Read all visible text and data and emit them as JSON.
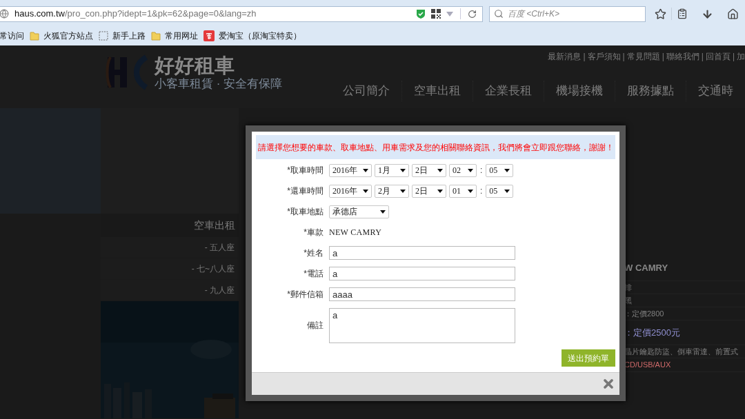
{
  "browser": {
    "url_host": "haus.com.tw",
    "url_path": "/pro_con.php?idept=1&pk=62&page=0&lang=zh",
    "search_placeholder": "百度 <Ctrl+K>",
    "bookmarks": [
      {
        "label": "常访问",
        "kind": "plain"
      },
      {
        "label": "火狐官方站点",
        "kind": "folder"
      },
      {
        "label": "新手上路",
        "kind": "blank"
      },
      {
        "label": "常用网址",
        "kind": "folder"
      },
      {
        "label": "爱淘宝（原淘宝特卖）",
        "kind": "taobao"
      }
    ]
  },
  "site": {
    "logo_title": "好好租車",
    "logo_tagline": "小客車租賃 · 安全有保障",
    "top_links": [
      "最新消息",
      "客戶須知",
      "常見問題",
      "聯絡我們",
      "回首頁",
      "加"
    ],
    "link_separator": "|",
    "nav": [
      "公司簡介",
      "空車出租",
      "企業長租",
      "機場接機",
      "服務據點",
      "交通時"
    ],
    "sidebar": {
      "heading": "空車出租",
      "items": [
        "- 五人座",
        "- 七~八人座",
        "- 九人座"
      ]
    },
    "details": [
      {
        "text": "W CAMRY",
        "kind": "title"
      },
      {
        "text": "排",
        "kind": "plain"
      },
      {
        "text": "黑",
        "kind": "plain"
      },
      {
        "text": "：定價2800",
        "kind": "plain"
      },
      {
        "text": "：定價2500元",
        "kind": "price"
      },
      {
        "text": "晶片鑰匙防盜、倒車雷達、前置式",
        "kind": "plain"
      },
      {
        "text": "CD/USB/AUX",
        "kind": "red"
      }
    ]
  },
  "modal": {
    "notice": "請選擇您想要的車款、取車地點、用車需求及您的相關聯絡資訊，我們將會立即跟您聯絡，謝謝！",
    "fields": [
      {
        "label": "*取車時間",
        "kind": "datetime",
        "selects": [
          "2016年",
          "1月",
          "2日",
          "02",
          "05"
        ],
        "separator": ":"
      },
      {
        "label": "*還車時間",
        "kind": "datetime",
        "selects": [
          "2016年",
          "2月",
          "2日",
          "01",
          "05"
        ],
        "separator": ":"
      },
      {
        "label": "*取車地點",
        "kind": "select",
        "value": "承德店"
      },
      {
        "label": "*車款",
        "kind": "static",
        "value": "NEW CAMRY"
      },
      {
        "label": "*姓名",
        "kind": "input",
        "value": "a"
      },
      {
        "label": "*電話",
        "kind": "input",
        "value": "a"
      },
      {
        "label": "*郵件信箱",
        "kind": "input",
        "value": "aaaa"
      },
      {
        "label": "備註",
        "kind": "textarea",
        "value": "a"
      }
    ],
    "submit": "送出預約單"
  }
}
